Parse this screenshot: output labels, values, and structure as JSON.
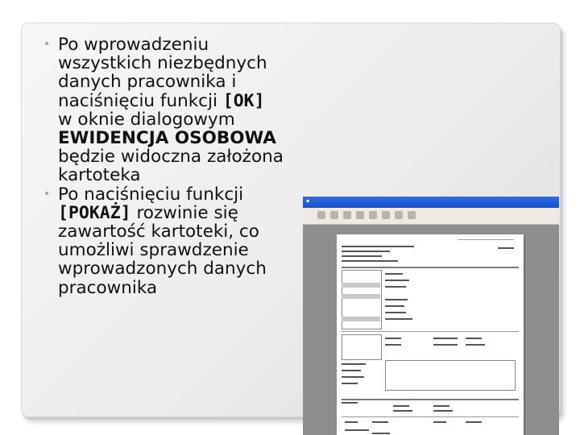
{
  "bullets": [
    {
      "parts": [
        {
          "text": "Po wprowadzeniu wszystkich niezbędnych danych pracownika i naciśnięciu funkcji ",
          "style": "normal"
        },
        {
          "text": "[OK]",
          "style": "mono"
        },
        {
          "text": "  w oknie dialogowym ",
          "style": "normal"
        },
        {
          "text": "EWIDENCJA OSOBOWA",
          "style": "bold"
        },
        {
          "text": " będzie widoczna założona kartoteka",
          "style": "normal"
        }
      ]
    },
    {
      "parts": [
        {
          "text": "Po naciśnięciu funkcji ",
          "style": "normal"
        },
        {
          "text": "[POKAŻ]",
          "style": "mono"
        },
        {
          "text": " rozwinie się zawartość  kartoteki, co umożliwi sprawdzenie wprowadzonych danych pracownika",
          "style": "normal"
        }
      ]
    }
  ],
  "bullet_symbol": "•",
  "colors": {
    "bullet": "#8aa3c9",
    "titlebar": "#2f6fe0",
    "workspace": "#8e8e8e"
  }
}
